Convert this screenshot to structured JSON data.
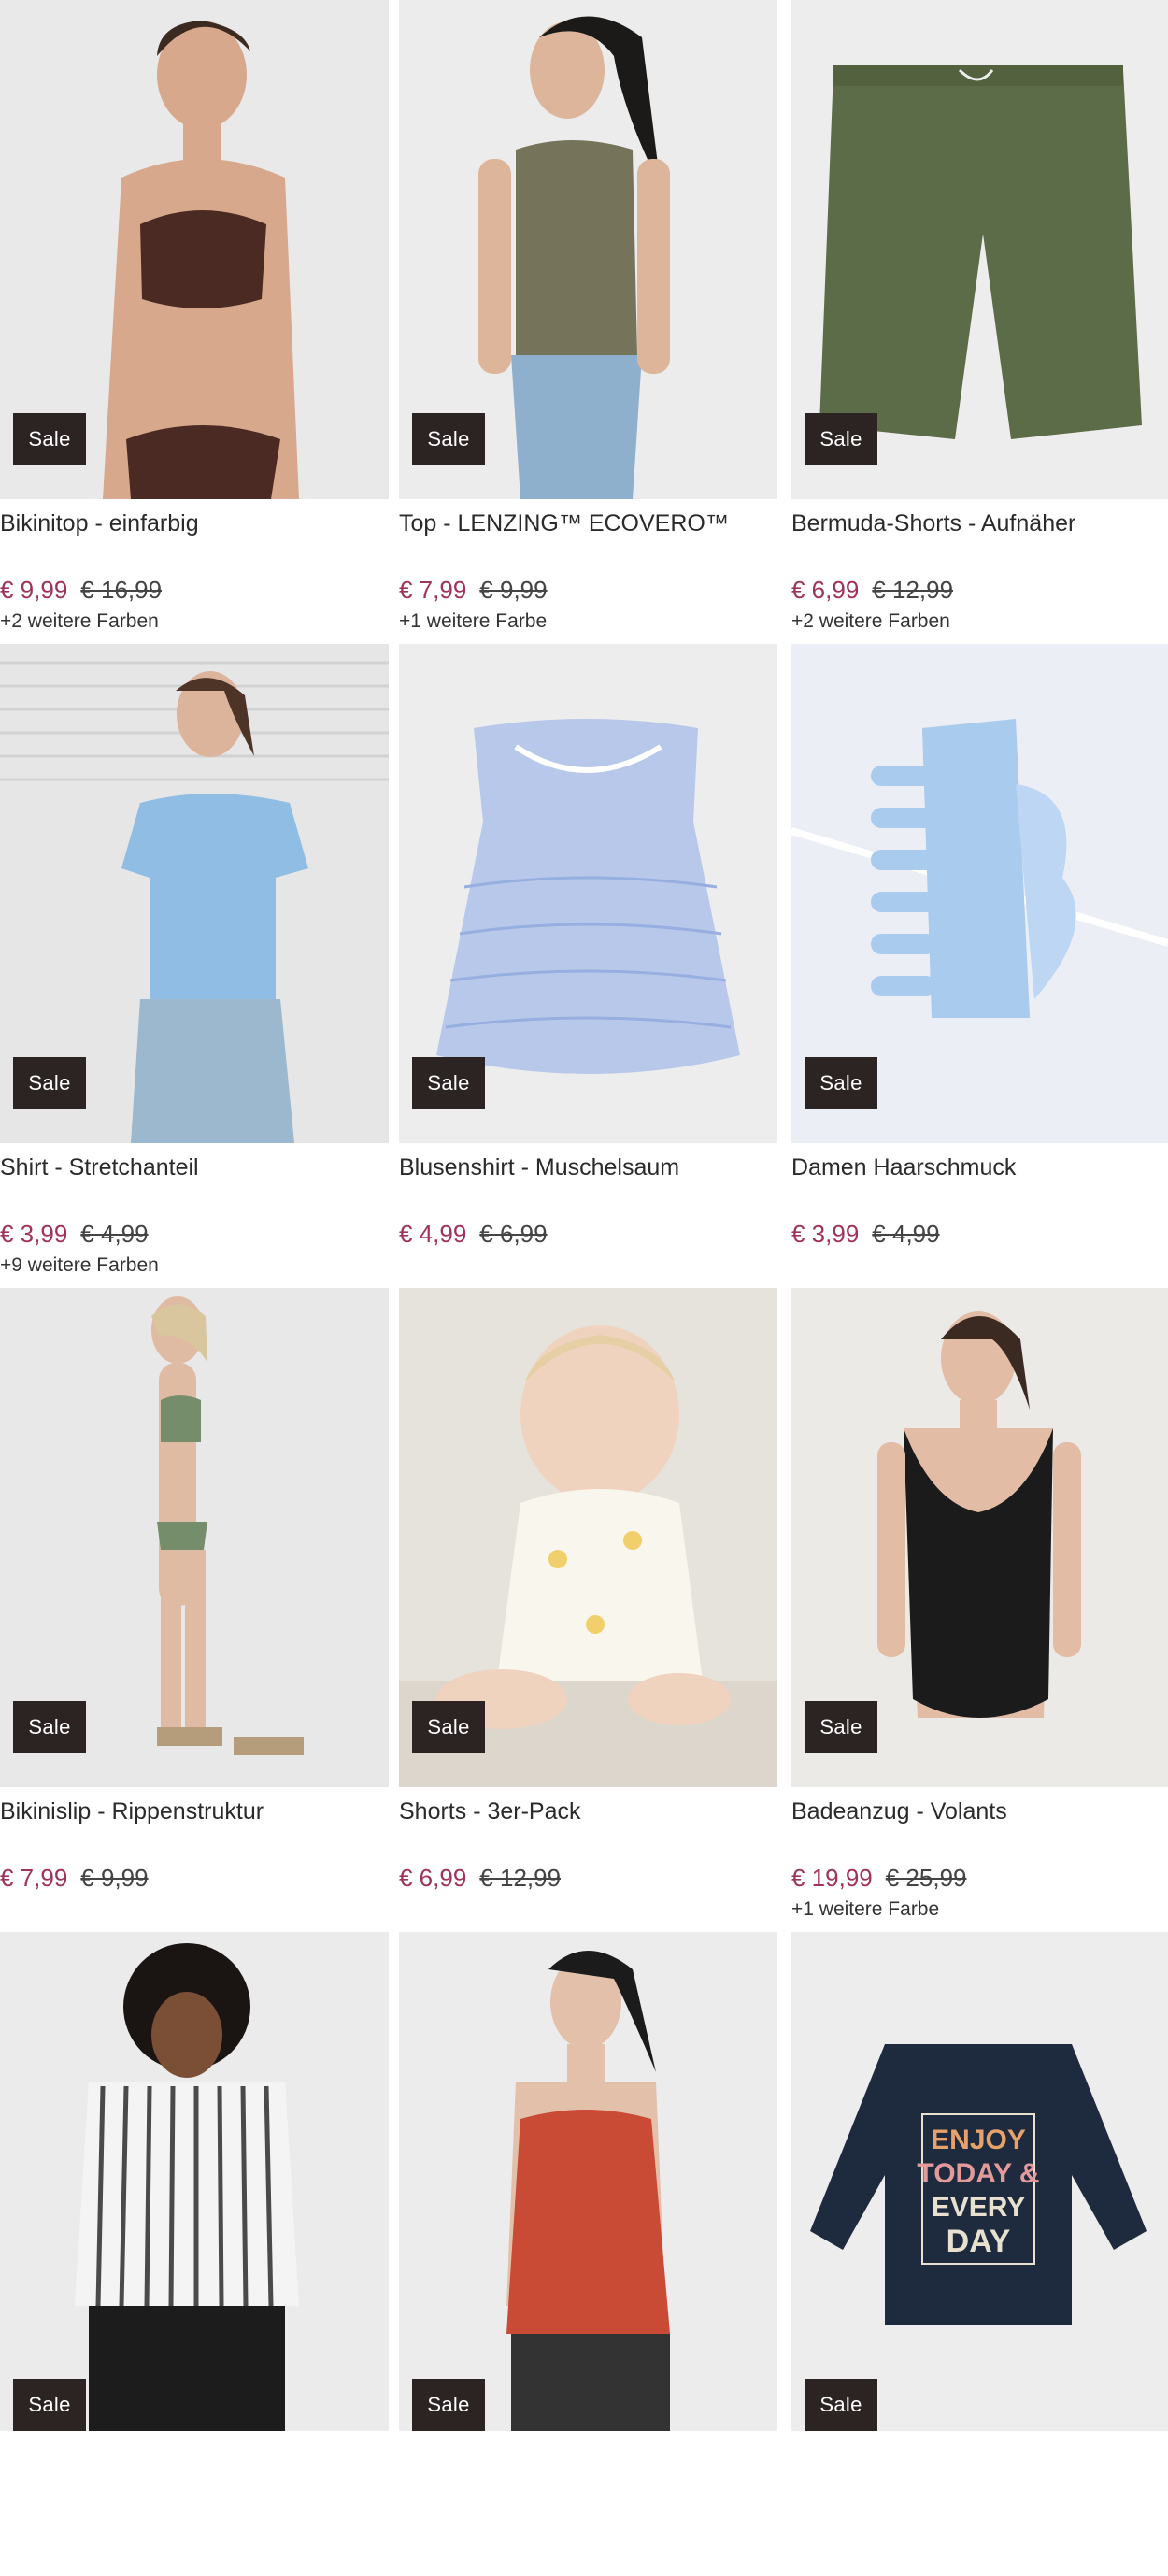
{
  "sale_label": "Sale",
  "colors": {
    "price_new": "#a0335b",
    "sale_badge_bg": "#2b2422"
  },
  "products": [
    {
      "title": "Bikinitop - einfarbig",
      "price_new": "€ 9,99",
      "price_old": "€ 16,99",
      "colors_note": "+2 weitere Farben"
    },
    {
      "title": "Top - LENZING™ ECOVERO™",
      "price_new": "€ 7,99",
      "price_old": "€ 9,99",
      "colors_note": "+1 weitere Farbe"
    },
    {
      "title": "Bermuda-Shorts - Aufnäher",
      "price_new": "€ 6,99",
      "price_old": "€ 12,99",
      "colors_note": "+2 weitere Farben"
    },
    {
      "title": "Shirt - Stretchanteil",
      "price_new": "€ 3,99",
      "price_old": "€ 4,99",
      "colors_note": "+9 weitere Farben"
    },
    {
      "title": "Blusenshirt - Muschelsaum",
      "price_new": "€ 4,99",
      "price_old": "€ 6,99",
      "colors_note": ""
    },
    {
      "title": "Damen Haarschmuck",
      "price_new": "€ 3,99",
      "price_old": "€ 4,99",
      "colors_note": ""
    },
    {
      "title": "Bikinislip - Rippenstruktur",
      "price_new": "€ 7,99",
      "price_old": "€ 9,99",
      "colors_note": ""
    },
    {
      "title": "Shorts - 3er-Pack",
      "price_new": "€ 6,99",
      "price_old": "€ 12,99",
      "colors_note": ""
    },
    {
      "title": "Badeanzug - Volants",
      "price_new": "€ 19,99",
      "price_old": "€ 25,99",
      "colors_note": "+1 weitere Farbe"
    },
    {
      "title": "",
      "price_new": "",
      "price_old": "",
      "colors_note": ""
    },
    {
      "title": "",
      "price_new": "",
      "price_old": "",
      "colors_note": ""
    },
    {
      "title": "",
      "price_new": "",
      "price_old": "",
      "colors_note": ""
    }
  ],
  "print_text": {
    "line1": "ENJOY",
    "line2": "TODAY &",
    "line3": "EVERY",
    "line4": "DAY"
  }
}
